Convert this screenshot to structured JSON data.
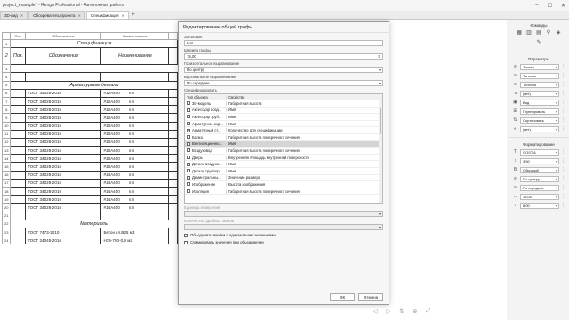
{
  "window": {
    "title": "project_example* - Renga Professional - Автономная работа"
  },
  "tabs": [
    {
      "label": "3D-вид"
    },
    {
      "label": "Обозреватель проекта"
    },
    {
      "label": "Спецификация"
    }
  ],
  "spec": {
    "col_headers": [
      "Поз.",
      "Обозначение",
      "Наименование"
    ],
    "title": "Спецификация",
    "head": {
      "pos": "Поз.",
      "designation": "Обозначение",
      "name": "Наименование"
    },
    "section1": "Арматурные детали",
    "rows": [
      {
        "n": "6",
        "d": "ГОСТ 34028-2016",
        "nm": "#12А400",
        "u": "п.п"
      },
      {
        "n": "7",
        "d": "ГОСТ 34028-2016",
        "nm": "#12А400",
        "u": "п.п"
      },
      {
        "n": "8",
        "d": "ГОСТ 34028-2016",
        "nm": "#12А400",
        "u": "п.п"
      },
      {
        "n": "9",
        "d": "ГОСТ 34028-2016",
        "nm": "#12А400",
        "u": "п.п"
      },
      {
        "n": "10",
        "d": "ГОСТ 34028-2016",
        "nm": "#10А400",
        "u": "п.п"
      },
      {
        "n": "11",
        "d": "ГОСТ 34028-2016",
        "nm": "#10А400",
        "u": "п.п"
      },
      {
        "n": "12",
        "d": "ГОСТ 34028-2016",
        "nm": "#10А400",
        "u": "п.п"
      },
      {
        "n": "13",
        "d": "ГОСТ 34028-2016",
        "nm": "#10А400",
        "u": "п.п"
      },
      {
        "n": "14",
        "d": "ГОСТ 34028-2016",
        "nm": "#10А400",
        "u": "п.п"
      },
      {
        "n": "15",
        "d": "ГОСТ 34028-2016",
        "nm": "#10А400",
        "u": "п.п"
      },
      {
        "n": "16",
        "d": "ГОСТ 34028-2016",
        "nm": "#14А400",
        "u": "п.п"
      },
      {
        "n": "17",
        "d": "ГОСТ 34028-2016",
        "nm": "#14А400",
        "u": "п.п"
      },
      {
        "n": "18",
        "d": "ГОСТ 34028-2016",
        "nm": "#14А400",
        "u": "п.п"
      },
      {
        "n": "19",
        "d": "ГОСТ 34028-2016",
        "nm": "#14А400",
        "u": "п.п"
      },
      {
        "n": "20",
        "d": "ГОСТ 34028-2016",
        "nm": "#14А400",
        "u": "п.п"
      }
    ],
    "section2": "Материалы",
    "rows2": [
      {
        "n": "23",
        "d": "ГОСТ 7473-2010",
        "nm": "Бетон кл.В25 м3"
      },
      {
        "n": "24",
        "d": "ГОСТ 24045-2016",
        "nm": "Н75-750-0,9 м2"
      }
    ]
  },
  "dialog": {
    "title": "Редактирование общей графы",
    "header_label": "Заголовок",
    "header_value": "Кол.",
    "width_label": "Ширина графы",
    "width_value": "15,00",
    "halign_label": "Горизонтальное выравнивание",
    "halign_value": "По центру",
    "valign_label": "Вертикальное выравнивание",
    "valign_value": "По середине",
    "specify_label": "Специфицировать",
    "grid_head": [
      "Тип объекта",
      "Свойство"
    ],
    "grid_rows": [
      {
        "t": "3D-модель",
        "p": "Габаритная высота",
        "c": false
      },
      {
        "t": "Аксессуар возд...",
        "p": "Имя",
        "c": false
      },
      {
        "t": "Аксессуар труб...",
        "p": "Имя",
        "c": false
      },
      {
        "t": "Арматурное изд...",
        "p": "Имя",
        "c": false
      },
      {
        "t": "Арматурный ст...",
        "p": "Количество для спецификации",
        "c": true
      },
      {
        "t": "Балка",
        "p": "Габаритная высота поперечного сечения",
        "c": false
      },
      {
        "t": "Вентиляционно...",
        "p": "Имя",
        "c": false,
        "sel": true
      },
      {
        "t": "Воздуховод",
        "p": "Габаритная высота поперечного сечения",
        "c": false
      },
      {
        "t": "Дверь",
        "p": "Внутренняя площадь внутренней поверхности",
        "c": false
      },
      {
        "t": "Деталь воздухо...",
        "p": "Имя",
        "c": false
      },
      {
        "t": "Деталь трубопр...",
        "p": "Имя",
        "c": false
      },
      {
        "t": "Деминтральны...",
        "p": "Значение размера",
        "c": false
      },
      {
        "t": "Изображение",
        "p": "Высота изображения",
        "c": false
      },
      {
        "t": "Изоляция",
        "p": "Габаритная высота поперечного сечения",
        "c": false
      }
    ],
    "unit_label": "Единица измерения",
    "decimals_label": "Количество дробных знаков",
    "merge_label": "Объединять ячейки с одинаковыми значениями",
    "sum_label": "Суммировать значения при объединении",
    "ok": "ОК",
    "cancel": "Отмена"
  },
  "panel": {
    "commands": "Команды",
    "params": "Параметры",
    "p_rows": [
      "Тонкая",
      "Толстая",
      "Толстая",
      "(нет)",
      "Вид",
      "Группировать",
      "Сортировать",
      "(нет)"
    ],
    "format": "Форматирование",
    "f_rows": [
      "GOST A",
      "3,50",
      "Обычный",
      "По центру",
      "По середине",
      "15,00",
      "8,00"
    ]
  }
}
